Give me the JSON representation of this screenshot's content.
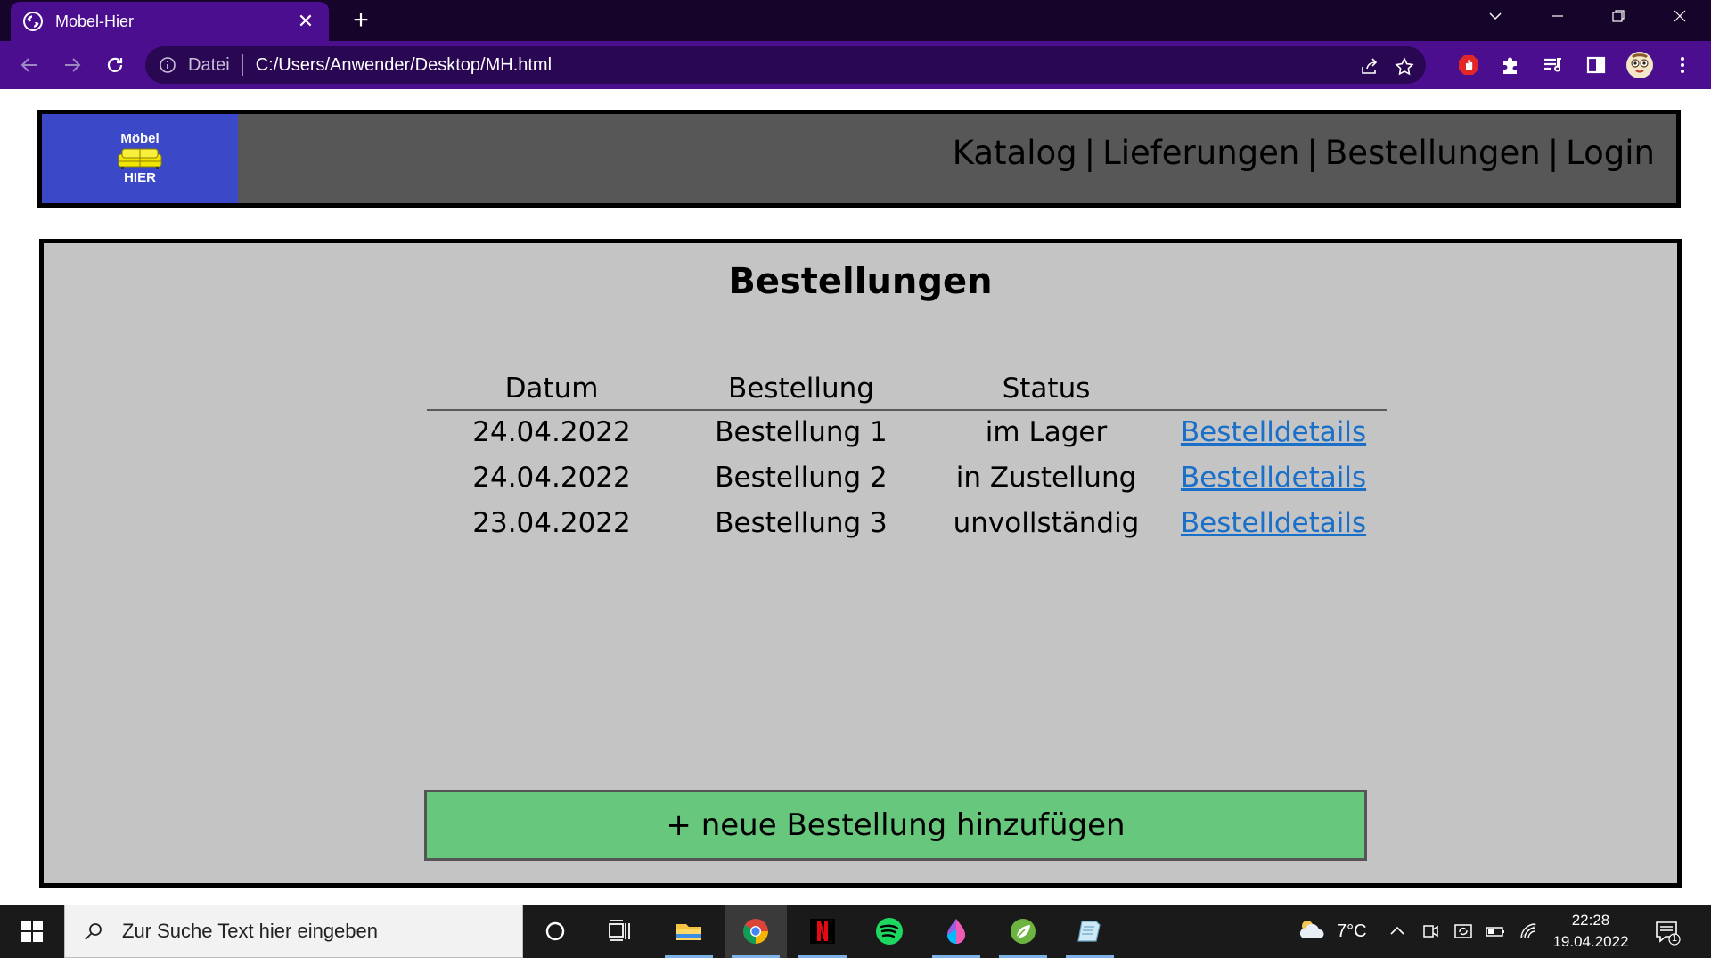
{
  "browser": {
    "tab_title": "Mobel-Hier",
    "tab_close": "✕",
    "new_tab": "+",
    "address_scheme": "Datei",
    "address_url": "C:/Users/Anwender/Desktop/MH.html"
  },
  "site": {
    "logo": {
      "top_text": "Möbel",
      "bottom_text": "HIER"
    },
    "nav": {
      "katalog": "Katalog",
      "lieferungen": "Lieferungen",
      "bestellungen": "Bestellungen",
      "login": "Login",
      "separator": "|"
    }
  },
  "page": {
    "title": "Bestellungen",
    "table": {
      "headers": [
        "Datum",
        "Bestellung",
        "Status"
      ],
      "rows": [
        {
          "datum": "24.04.2022",
          "bestellung": "Bestellung 1",
          "status": "im Lager",
          "link": "Bestelldetails"
        },
        {
          "datum": "24.04.2022",
          "bestellung": "Bestellung 2",
          "status": "in Zustellung",
          "link": "Bestelldetails"
        },
        {
          "datum": "23.04.2022",
          "bestellung": "Bestellung 3",
          "status": "unvollständig",
          "link": "Bestelldetails"
        }
      ]
    },
    "add_button": "+ neue Bestellung hinzufügen"
  },
  "taskbar": {
    "search_placeholder": "Zur Suche Text hier eingeben",
    "weather": "7°C",
    "time": "22:28",
    "date": "19.04.2022",
    "notification_count": "1"
  },
  "colors": {
    "browser_frame": "#4a0e8f",
    "tab_strip": "#16042a",
    "header_bg": "#575757",
    "logo_bg": "#3b49c9",
    "panel_bg": "#c4c4c4",
    "link": "#1a6fc9",
    "add_button": "#66c77d"
  }
}
